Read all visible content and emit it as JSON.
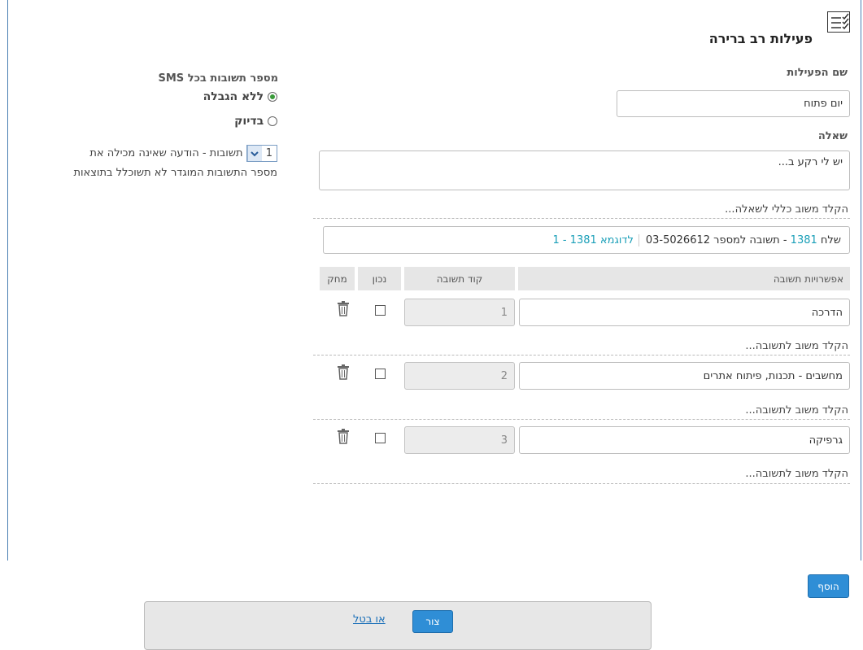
{
  "header": {
    "title": "פעילות רב ברירה",
    "icon": "checklist-icon"
  },
  "activity_name": {
    "label": "שם הפעילות",
    "value": "יום פתוח"
  },
  "question": {
    "label": "שאלה",
    "value": "יש לי רקע ב..."
  },
  "question_feedback": {
    "placeholder": "הקלד משוב כללי לשאלה..."
  },
  "send_line": {
    "prefix": "שלח",
    "code": "1381",
    "middle": "- תשובה למספר 03-5026612",
    "example": "לדוגמא 1381 - 1"
  },
  "table": {
    "headers": {
      "options": "אפשרויות תשובה",
      "code": "קוד תשובה",
      "correct": "נכון",
      "delete": "מחק"
    },
    "rows": [
      {
        "answer": "הדרכה",
        "code": "1",
        "correct": false,
        "feedback": "הקלד משוב לתשובה..."
      },
      {
        "answer": "מחשבים - תכנות, פיתוח אתרים",
        "code": "2",
        "correct": false,
        "feedback": "הקלד משוב לתשובה..."
      },
      {
        "answer": "גרפיקה",
        "code": "3",
        "correct": false,
        "feedback": "הקלד משוב לתשובה..."
      }
    ]
  },
  "add_button": {
    "label": "הוסף"
  },
  "sms_panel": {
    "title": "מספר תשובות בכל SMS",
    "option_unlimited": "ללא הגבלה",
    "option_exact": "בדיוק",
    "selected": "unlimited",
    "count_value": "1",
    "count_suffix": "תשובות - הודעה שאינה מכילה את",
    "note_line2": "מספר התשובות המוגדר לא תשוכלל בתוצאות"
  },
  "footer": {
    "save_label": "צור",
    "cancel_label": "או בטל"
  },
  "colors": {
    "accent": "#2f8ed6",
    "link": "#1a9fb8",
    "frame": "#4a7fb3"
  }
}
